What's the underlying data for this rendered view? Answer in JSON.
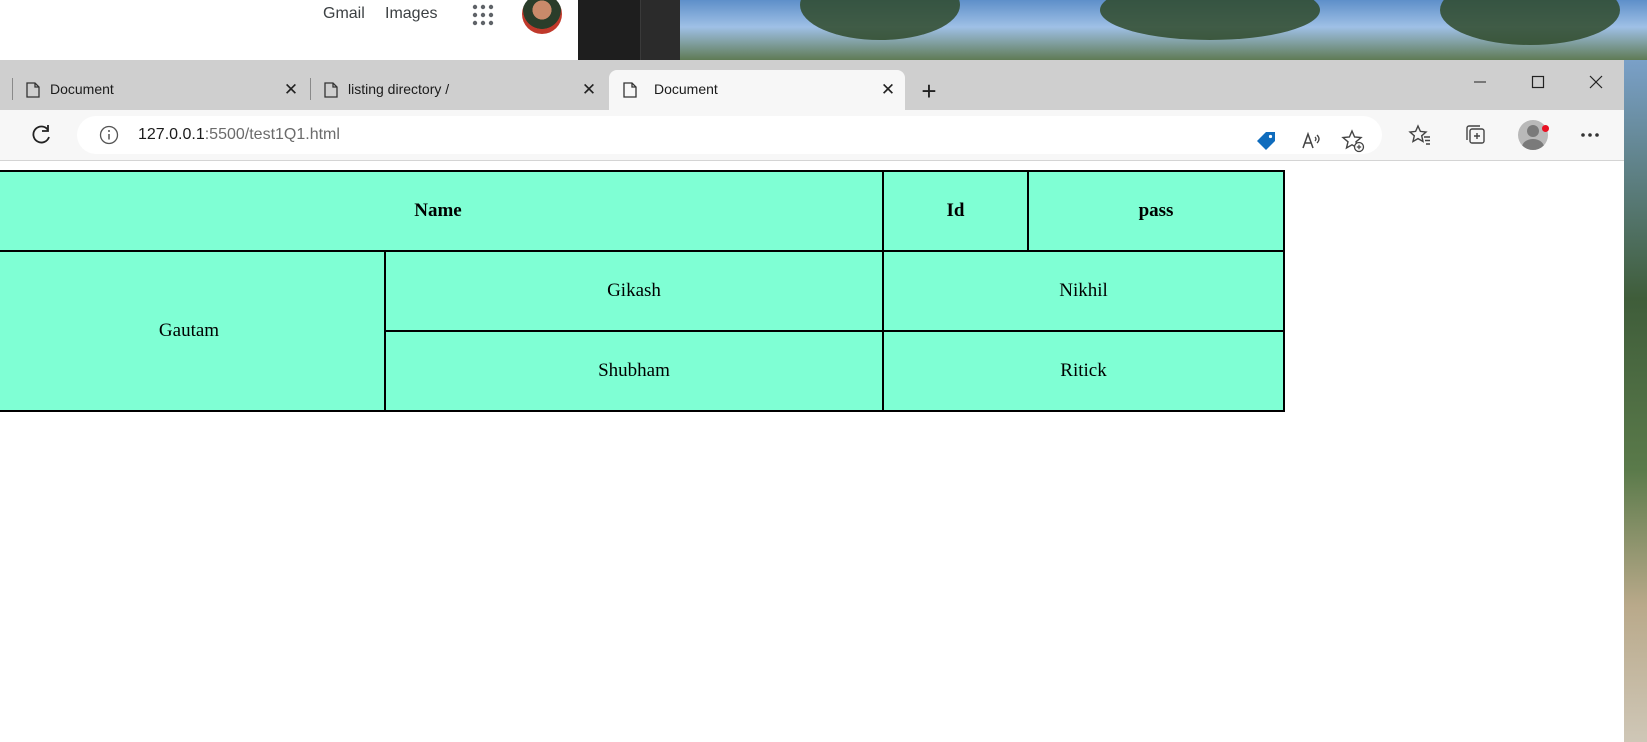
{
  "background_google": {
    "gmail": "Gmail",
    "images": "Images"
  },
  "tabs": [
    {
      "label": "Document",
      "icon": "document-icon",
      "active": false
    },
    {
      "label": "listing directory /",
      "icon": "document-icon",
      "active": false
    },
    {
      "label": "Document",
      "icon": "document-icon",
      "active": true
    }
  ],
  "address_bar": {
    "host": "127.0.0.1",
    "path": ":5500/test1Q1.html"
  },
  "colors": {
    "table_bg": "#7fffd4",
    "tab_strip": "#cfcfcf",
    "active_tab": "#f7f7f7",
    "accent_blue": "#0f6cbd",
    "notification": "#e81123"
  },
  "table": {
    "headers": {
      "name": "Name",
      "id": "Id",
      "pass": "pass"
    },
    "rowspan_cell": "Gautam",
    "rows": [
      [
        "Gikash",
        "Nikhil"
      ],
      [
        "Shubham",
        "Ritick"
      ]
    ]
  }
}
